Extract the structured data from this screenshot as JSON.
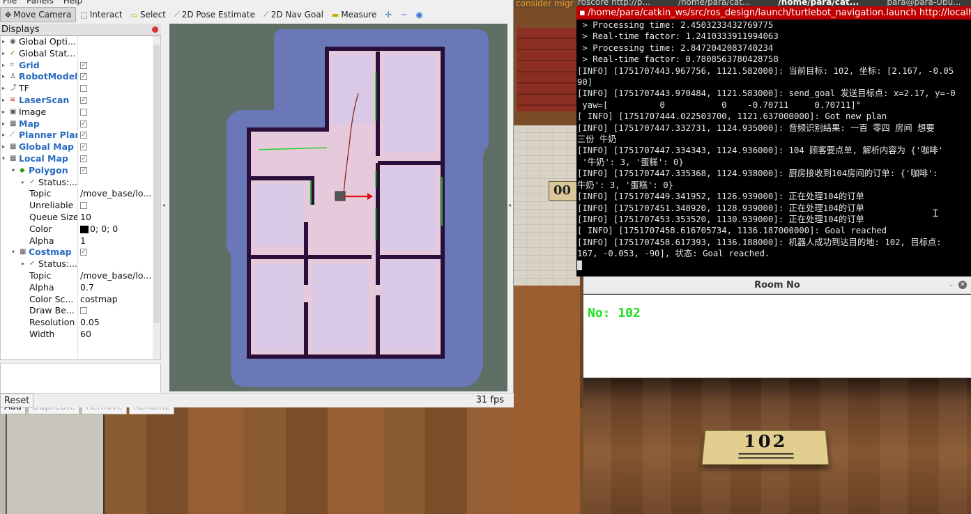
{
  "rviz": {
    "menu": [
      "File",
      "Panels",
      "Help"
    ],
    "tools": [
      {
        "label": "Move Camera",
        "icon": "move-camera-icon",
        "glyph": "✥",
        "active": true,
        "color": ""
      },
      {
        "label": "Interact",
        "icon": "interact-icon",
        "glyph": "⬚",
        "active": false,
        "color": ""
      },
      {
        "label": "Select",
        "icon": "select-icon",
        "glyph": "▭",
        "active": false,
        "color": "yellow"
      },
      {
        "label": "2D Pose Estimate",
        "icon": "pose-estimate-icon",
        "glyph": "⟋",
        "active": false,
        "color": "green"
      },
      {
        "label": "2D Nav Goal",
        "icon": "nav-goal-icon",
        "glyph": "⟋",
        "active": false,
        "color": "purple"
      },
      {
        "label": "Measure",
        "icon": "measure-icon",
        "glyph": "▬",
        "active": false,
        "color": "yellow"
      }
    ],
    "displays_title": "Displays",
    "tree": [
      {
        "indent": 0,
        "arrow": "▸",
        "icon": "◉",
        "name": "Global Opti...",
        "bold": false,
        "value": "",
        "check": null
      },
      {
        "indent": 0,
        "arrow": "▸",
        "icon": "✓",
        "name": "Global Stat...",
        "bold": false,
        "value": "",
        "check": null
      },
      {
        "indent": 0,
        "arrow": "▸",
        "icon": "⌗",
        "name": "Grid",
        "bold": true,
        "value": "",
        "check": true
      },
      {
        "indent": 0,
        "arrow": "▸",
        "icon": "♙",
        "name": "RobotModel",
        "bold": true,
        "value": "",
        "check": true
      },
      {
        "indent": 0,
        "arrow": "▸",
        "icon": "⤴",
        "name": "TF",
        "bold": false,
        "value": "",
        "check": false
      },
      {
        "indent": 0,
        "arrow": "▸",
        "icon": "≋",
        "name": "LaserScan",
        "bold": true,
        "value": "",
        "check": true
      },
      {
        "indent": 0,
        "arrow": "▸",
        "icon": "▣",
        "name": "Image",
        "bold": false,
        "value": "",
        "check": false
      },
      {
        "indent": 0,
        "arrow": "▸",
        "icon": "▦",
        "name": "Map",
        "bold": true,
        "value": "",
        "check": true
      },
      {
        "indent": 0,
        "arrow": "▸",
        "icon": "⟋",
        "name": "Planner Plan",
        "bold": true,
        "value": "",
        "check": true
      },
      {
        "indent": 0,
        "arrow": "▸",
        "icon": "▦",
        "name": "Global Map",
        "bold": true,
        "value": "",
        "check": true
      },
      {
        "indent": 0,
        "arrow": "▾",
        "icon": "▦",
        "name": "Local Map",
        "bold": true,
        "value": "",
        "check": true
      },
      {
        "indent": 1,
        "arrow": "▾",
        "icon": "◆",
        "name": "Polygon",
        "bold": true,
        "value": "",
        "check": true
      },
      {
        "indent": 2,
        "arrow": "▸",
        "icon": "✓",
        "name": "Status:...",
        "bold": false,
        "value": "",
        "check": null
      },
      {
        "indent": 2,
        "arrow": "",
        "icon": "",
        "name": "Topic",
        "bold": false,
        "value": "/move_base/lo...",
        "check": null
      },
      {
        "indent": 2,
        "arrow": "",
        "icon": "",
        "name": "Unreliable",
        "bold": false,
        "value": "",
        "check": false
      },
      {
        "indent": 2,
        "arrow": "",
        "icon": "",
        "name": "Queue Size",
        "bold": false,
        "value": "10",
        "check": null
      },
      {
        "indent": 2,
        "arrow": "",
        "icon": "",
        "name": "Color",
        "bold": false,
        "value": "0; 0; 0",
        "check": null,
        "swatch": "#000000"
      },
      {
        "indent": 2,
        "arrow": "",
        "icon": "",
        "name": "Alpha",
        "bold": false,
        "value": "1",
        "check": null
      },
      {
        "indent": 1,
        "arrow": "▾",
        "icon": "▦",
        "name": "Costmap",
        "bold": true,
        "value": "",
        "check": true
      },
      {
        "indent": 2,
        "arrow": "▸",
        "icon": "✓",
        "name": "Status:...",
        "bold": false,
        "value": "",
        "check": null
      },
      {
        "indent": 2,
        "arrow": "",
        "icon": "",
        "name": "Topic",
        "bold": false,
        "value": "/move_base/lo...",
        "check": null
      },
      {
        "indent": 2,
        "arrow": "",
        "icon": "",
        "name": "Alpha",
        "bold": false,
        "value": "0.7",
        "check": null
      },
      {
        "indent": 2,
        "arrow": "",
        "icon": "",
        "name": "Color Sc...",
        "bold": false,
        "value": "costmap",
        "check": null
      },
      {
        "indent": 2,
        "arrow": "",
        "icon": "",
        "name": "Draw Be...",
        "bold": false,
        "value": "",
        "check": false
      },
      {
        "indent": 2,
        "arrow": "",
        "icon": "",
        "name": "Resolution",
        "bold": false,
        "value": "0.05",
        "check": null
      },
      {
        "indent": 2,
        "arrow": "",
        "icon": "",
        "name": "Width",
        "bold": false,
        "value": "60",
        "check": null
      }
    ],
    "buttons": {
      "add": "Add",
      "duplicate": "Duplicate",
      "remove": "Remove",
      "rename": "Rename",
      "reset": "Reset"
    },
    "fps": "31 fps"
  },
  "background": {
    "top_strip": "consider migr",
    "plate": "00"
  },
  "terminal": {
    "tabs": [
      "roscore http://p...",
      "/home/para/cat...",
      "/home/para/cat...",
      "para@para-Ubu..."
    ],
    "active_tab": 2,
    "title": "/home/para/catkin_ws/src/ros_design/launch/turtlebot_navigation.launch http://localhost",
    "lines": [
      " > Processing time: 2.4503233432769775",
      " > Real-time factor: 1.2410333911994063",
      " > Processing time: 2.8472042083740234",
      " > Real-time factor: 0.7808563780428758",
      "[INFO] [1751707443.967756, 1121.582000]: 当前目标: 102, 坐标: [2.167, -0.05",
      "90]",
      "[INFO] [1751707443.970484, 1121.583000]: send_goal 发送目标点: x=2.17, y=-0",
      " yaw=[          0           0    -0.70711     0.70711]°",
      "[ INFO] [1751707444.022503700, 1121.637000000]: Got new plan",
      "[INFO] [1751707447.332731, 1124.935000]: 音频识别结果: 一百 零四 房间 想要",
      "三份 牛奶",
      "[INFO] [1751707447.334343, 1124.936000]: 104 顾客要点单, 解析内容为 {'咖啡'",
      " '牛奶': 3, '蛋糕': 0}",
      "[INFO] [1751707447.335368, 1124.938000]: 厨房接收到104房间的订单: {'咖啡':",
      "牛奶': 3, '蛋糕': 0}",
      "[INFO] [1751707449.341952, 1126.939000]: 正在处理104的订单",
      "[INFO] [1751707451.348920, 1128.939000]: 正在处理104的订单",
      "[INFO] [1751707453.353520, 1130.939000]: 正在处理104的订单",
      "[ INFO] [1751707458.616705734, 1136.187000000]: Goal reached",
      "[INFO] [1751707458.617393, 1136.188000]: 机器人成功到达目的地: 102, 目标点:",
      "167, -0.053, -90], 状态: Goal reached."
    ]
  },
  "room": {
    "title": "Room No",
    "label": "No: 102",
    "placard": "102"
  },
  "colors": {
    "terminal_title": "#c00000",
    "room_label": "#20e020",
    "accent": "#2a6bc0"
  }
}
